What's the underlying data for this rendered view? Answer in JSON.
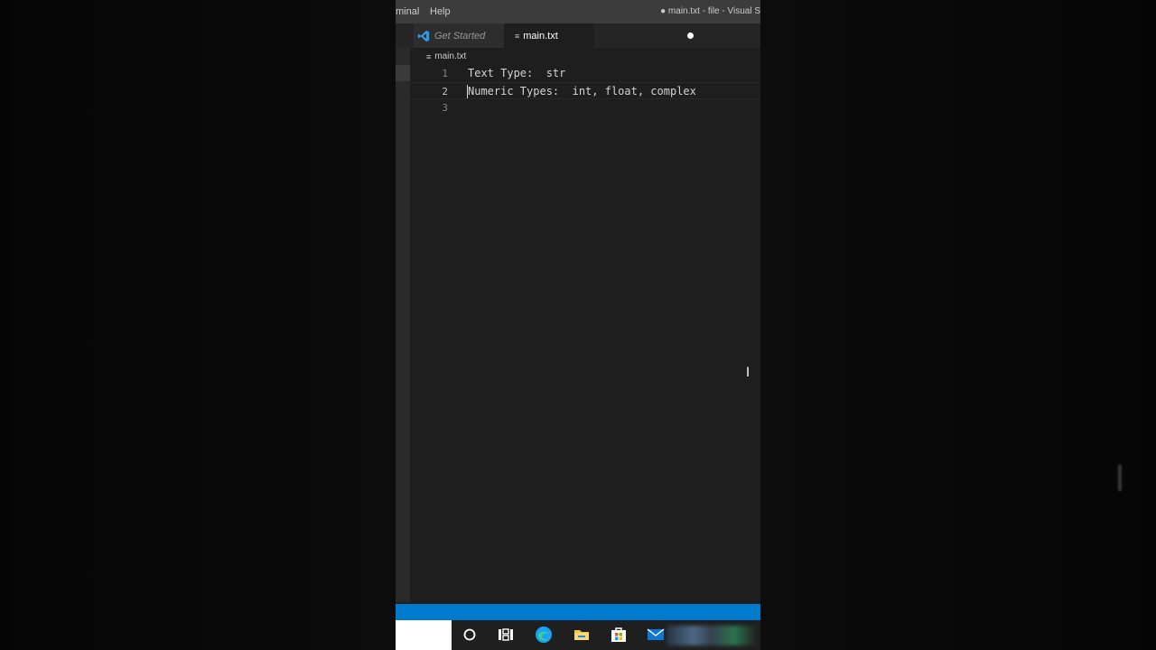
{
  "menu": {
    "terminal_label": "minal",
    "help_label": "Help"
  },
  "window": {
    "title": "● main.txt - file - Visual S"
  },
  "tabs": [
    {
      "label": "Get Started",
      "icon": "vscode-icon",
      "italic": true
    },
    {
      "label": "main.txt",
      "icon": "text-file-icon",
      "modified": true
    }
  ],
  "breadcrumb": {
    "file_label": "main.txt"
  },
  "editor": {
    "lines": [
      {
        "number": "1",
        "text": "Text Type:  str"
      },
      {
        "number": "2",
        "text": "Numeric Types:  int, float, complex"
      },
      {
        "number": "3",
        "text": ""
      }
    ],
    "active_line": 2
  },
  "colors": {
    "accent": "#007acc",
    "editor_bg": "#1e1e1e",
    "titlebar_bg": "#3c3c3c"
  },
  "taskbar": {
    "icons": [
      "cortana-icon",
      "task-view-icon",
      "edge-icon",
      "file-explorer-icon",
      "store-icon",
      "mail-icon"
    ]
  }
}
